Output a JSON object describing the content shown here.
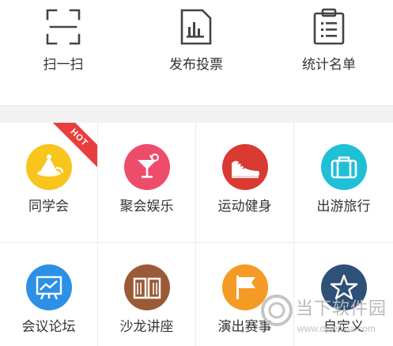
{
  "tools": [
    {
      "label": "扫一扫",
      "icon": "scan-icon"
    },
    {
      "label": "发布投票",
      "icon": "vote-chart-icon"
    },
    {
      "label": "统计名单",
      "icon": "clipboard-list-icon"
    }
  ],
  "categories": [
    {
      "label": "同学会",
      "icon": "party-hat-icon",
      "color": "#f8c51c",
      "badge": "HOT"
    },
    {
      "label": "聚会娱乐",
      "icon": "cocktail-icon",
      "color": "#ee4c6b"
    },
    {
      "label": "运动健身",
      "icon": "sneaker-icon",
      "color": "#d93a32"
    },
    {
      "label": "出游旅行",
      "icon": "suitcase-icon",
      "color": "#1fc0d6"
    },
    {
      "label": "会议论坛",
      "icon": "presentation-board-icon",
      "color": "#2c90e6"
    },
    {
      "label": "沙龙讲座",
      "icon": "open-book-icon",
      "color": "#9a5a37"
    },
    {
      "label": "演出赛事",
      "icon": "flag-icon",
      "color": "#f59a24"
    },
    {
      "label": "自定义",
      "icon": "star-icon",
      "color": "#2f5077"
    }
  ],
  "watermark": {
    "text": "当下软件园",
    "url": "www.downxia.com"
  }
}
